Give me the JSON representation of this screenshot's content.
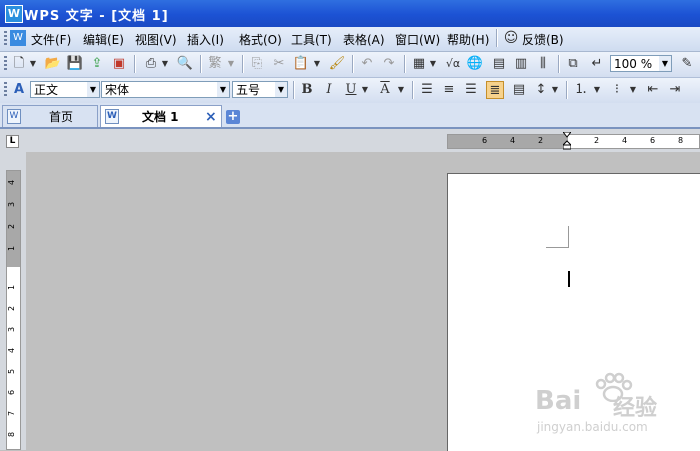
{
  "window": {
    "app_icon": "W",
    "title": "WPS 文字 - [文档 1]"
  },
  "menu": [
    "文件(F)",
    "编辑(E)",
    "视图(V)",
    "插入(I)",
    "格式(O)",
    "工具(T)",
    "表格(A)",
    "窗口(W)",
    "帮助(H)"
  ],
  "feedback_label": "反馈(B)",
  "toolbar": {
    "zoom_value": "100 %"
  },
  "format_bar": {
    "style_value": "正文",
    "font_value": "宋体",
    "size_value": "五号",
    "bold": "B",
    "italic": "I",
    "underline": "U",
    "font_color": "A"
  },
  "tabs": {
    "home_label": "首页",
    "doc_label": "文档 1",
    "close": "×",
    "add": "+"
  },
  "ruler": {
    "corner_label": "L",
    "h_ticks": [
      "6",
      "4",
      "2",
      "2",
      "4",
      "6",
      "8"
    ],
    "v_ticks": [
      "4",
      "3",
      "2",
      "1",
      "1",
      "2",
      "3",
      "4",
      "5",
      "6",
      "7",
      "8"
    ]
  },
  "watermark": {
    "brand": "Bai",
    "brand_suffix": "经验",
    "url": "jingyan.baidu.com"
  },
  "colors": {
    "title_bar": "#1c52d4",
    "workspace": "#c0c0c0",
    "accent": "#2f6fe0"
  }
}
